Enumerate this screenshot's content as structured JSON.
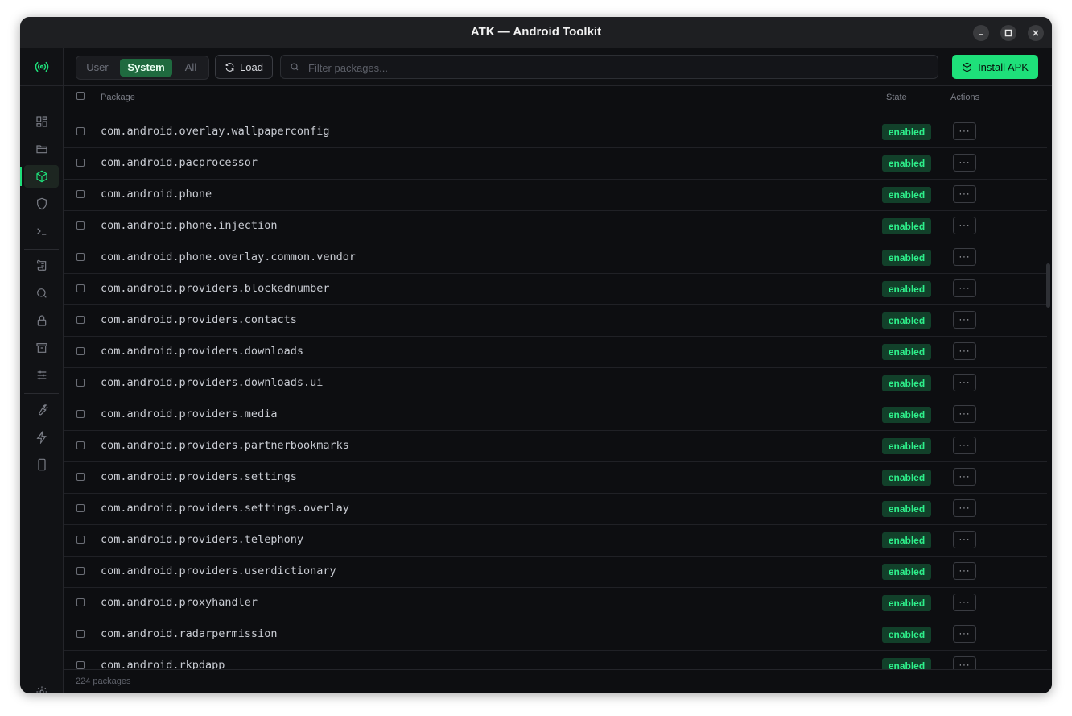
{
  "window": {
    "title": "ATK — Android Toolkit"
  },
  "sidebar": {
    "logo_icon": "radio-signal-icon",
    "items": [
      {
        "icon": "dashboard-grid-icon"
      },
      {
        "icon": "folder-icon"
      },
      {
        "icon": "package-box-icon",
        "active": true
      },
      {
        "icon": "shield-icon"
      },
      {
        "icon": "terminal-icon"
      },
      {
        "icon": "scroll-log-icon"
      },
      {
        "icon": "search-icon"
      },
      {
        "icon": "lock-icon"
      },
      {
        "icon": "archive-icon"
      },
      {
        "icon": "sliders-icon"
      },
      {
        "icon": "wrench-icon"
      },
      {
        "icon": "lightning-icon"
      },
      {
        "icon": "device-icon"
      }
    ],
    "settings_icon": "gear-icon"
  },
  "toolbar": {
    "filters": [
      "User",
      "System",
      "All"
    ],
    "active_filter": "System",
    "load_label": "Load",
    "search_placeholder": "Filter packages...",
    "install_label": "Install APK"
  },
  "table": {
    "columns": {
      "package": "Package",
      "state": "State",
      "actions": "Actions"
    },
    "rows": [
      {
        "package": "com.android.overlay.wallpaperconfig",
        "state": "enabled"
      },
      {
        "package": "com.android.pacprocessor",
        "state": "enabled"
      },
      {
        "package": "com.android.phone",
        "state": "enabled"
      },
      {
        "package": "com.android.phone.injection",
        "state": "enabled"
      },
      {
        "package": "com.android.phone.overlay.common.vendor",
        "state": "enabled"
      },
      {
        "package": "com.android.providers.blockednumber",
        "state": "enabled"
      },
      {
        "package": "com.android.providers.contacts",
        "state": "enabled"
      },
      {
        "package": "com.android.providers.downloads",
        "state": "enabled"
      },
      {
        "package": "com.android.providers.downloads.ui",
        "state": "enabled"
      },
      {
        "package": "com.android.providers.media",
        "state": "enabled"
      },
      {
        "package": "com.android.providers.partnerbookmarks",
        "state": "enabled"
      },
      {
        "package": "com.android.providers.settings",
        "state": "enabled"
      },
      {
        "package": "com.android.providers.settings.overlay",
        "state": "enabled"
      },
      {
        "package": "com.android.providers.telephony",
        "state": "enabled"
      },
      {
        "package": "com.android.providers.userdictionary",
        "state": "enabled"
      },
      {
        "package": "com.android.proxyhandler",
        "state": "enabled"
      },
      {
        "package": "com.android.radarpermission",
        "state": "enabled"
      },
      {
        "package": "com.android.rkpdapp",
        "state": "enabled"
      }
    ],
    "action_label": "···"
  },
  "footer": {
    "count_text": "224 packages"
  },
  "colors": {
    "accent": "#1ee07a",
    "badge_bg": "#12402a",
    "badge_text": "#2ef08b"
  }
}
